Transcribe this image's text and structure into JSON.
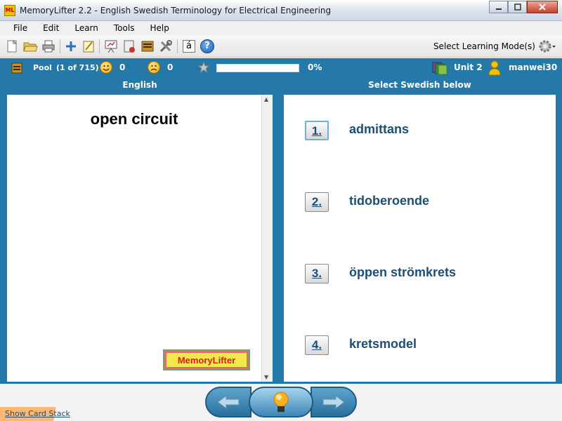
{
  "window": {
    "title": "MemoryLifter 2.2 - English Swedish Terminology for Electrical Engineering",
    "app_icon_text": "ML"
  },
  "menu": [
    "File",
    "Edit",
    "Learn",
    "Tools",
    "Help"
  ],
  "toolbar": {
    "icons": [
      "new-icon",
      "open-icon",
      "print-icon",
      "add-icon",
      "edit-icon",
      "presentation-icon",
      "statistics-icon",
      "cards-icon",
      "settings-tools-icon",
      "characters-icon",
      "help-icon"
    ],
    "characters_glyph": "á",
    "help_glyph": "?",
    "learning_mode_label": "Select Learning Mode(s)"
  },
  "status": {
    "pool_label": "Pool",
    "pool_count": "(1 of 715)",
    "right_count": "0",
    "wrong_count": "0",
    "progress_text": "0%",
    "progress_value": 0,
    "unit_label": "Unit 2",
    "user_label": "manwei30"
  },
  "left_pane": {
    "header": "English",
    "question": "open circuit",
    "logo_text": "MemoryLifter"
  },
  "right_pane": {
    "header": "Select Swedish below",
    "answers": [
      {
        "number": "1.",
        "text": "admittans"
      },
      {
        "number": "2.",
        "text": "tidoberoende"
      },
      {
        "number": "3.",
        "text": "öppen strömkrets"
      },
      {
        "number": "4.",
        "text": "kretsmodel"
      }
    ]
  },
  "bottom": {
    "show_card_stack": "Show Card Stack"
  },
  "colors": {
    "accent": "#2479a8",
    "answer_text": "#1d4e75",
    "orange_tab": "#ffb774"
  }
}
